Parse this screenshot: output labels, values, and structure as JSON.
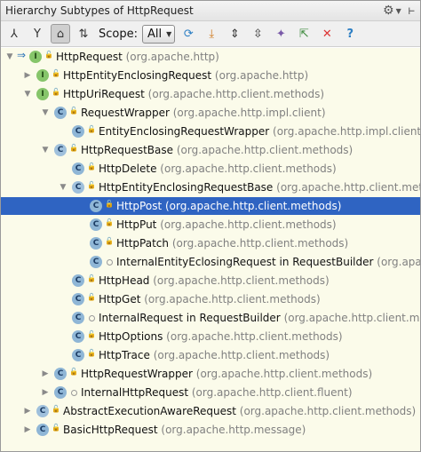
{
  "window": {
    "title": "Hierarchy Subtypes of HttpRequest"
  },
  "toolbar": {
    "scope_label": "Scope:",
    "scope_value": "All",
    "buttons": [
      {
        "name": "supertypes-hierarchy-icon",
        "glyph": "⅄"
      },
      {
        "name": "subtypes-hierarchy-icon",
        "glyph": "Y"
      },
      {
        "name": "class-hierarchy-icon",
        "glyph": "⌂",
        "active": true
      },
      {
        "name": "sort-alphabetically-icon",
        "glyph": "⇅"
      },
      {
        "name": "refresh-icon",
        "glyph": "⟳"
      },
      {
        "name": "export-icon",
        "glyph": "⤓"
      },
      {
        "name": "expand-all-icon",
        "glyph": "⇕"
      },
      {
        "name": "collapse-all-icon",
        "glyph": "⇳"
      },
      {
        "name": "pin-icon",
        "glyph": "✦"
      },
      {
        "name": "export-to-file-icon",
        "glyph": "⇱"
      },
      {
        "name": "close-icon",
        "glyph": "✕"
      },
      {
        "name": "help-icon",
        "glyph": "?"
      }
    ]
  },
  "tree": [
    {
      "depth": 0,
      "toggle": "▼",
      "kind": "int",
      "glyph": "I",
      "generic": true,
      "name": "HttpRequest",
      "pkg": "(org.apache.http)"
    },
    {
      "depth": 1,
      "toggle": "▶",
      "kind": "int",
      "glyph": "I",
      "name": "HttpEntityEnclosingRequest",
      "pkg": "(org.apache.http)"
    },
    {
      "depth": 1,
      "toggle": "▼",
      "kind": "int",
      "glyph": "I",
      "name": "HttpUriRequest",
      "pkg": "(org.apache.http.client.methods)"
    },
    {
      "depth": 2,
      "toggle": "▼",
      "kind": "class",
      "glyph": "C",
      "name": "RequestWrapper",
      "pkg": "(org.apache.http.impl.client)"
    },
    {
      "depth": 3,
      "toggle": "",
      "kind": "class",
      "glyph": "C",
      "name": "EntityEnclosingRequestWrapper",
      "pkg": "(org.apache.http.impl.client)"
    },
    {
      "depth": 2,
      "toggle": "▼",
      "kind": "abs",
      "glyph": "C",
      "name": "HttpRequestBase",
      "pkg": "(org.apache.http.client.methods)"
    },
    {
      "depth": 3,
      "toggle": "",
      "kind": "class",
      "glyph": "C",
      "name": "HttpDelete",
      "pkg": "(org.apache.http.client.methods)"
    },
    {
      "depth": 3,
      "toggle": "▼",
      "kind": "abs",
      "glyph": "C",
      "name": "HttpEntityEnclosingRequestBase",
      "pkg": "(org.apache.http.client.metho"
    },
    {
      "depth": 4,
      "toggle": "",
      "kind": "class",
      "glyph": "C",
      "name": "HttpPost",
      "pkg": "(org.apache.http.client.methods)",
      "selected": true
    },
    {
      "depth": 4,
      "toggle": "",
      "kind": "class",
      "glyph": "C",
      "name": "HttpPut",
      "pkg": "(org.apache.http.client.methods)"
    },
    {
      "depth": 4,
      "toggle": "",
      "kind": "class",
      "glyph": "C",
      "name": "HttpPatch",
      "pkg": "(org.apache.http.client.methods)"
    },
    {
      "depth": 4,
      "toggle": "",
      "kind": "class",
      "glyph": "C",
      "open": true,
      "name": "InternalEntityEclosingRequest in RequestBuilder",
      "pkg": "(org.apa"
    },
    {
      "depth": 3,
      "toggle": "",
      "kind": "class",
      "glyph": "C",
      "name": "HttpHead",
      "pkg": "(org.apache.http.client.methods)"
    },
    {
      "depth": 3,
      "toggle": "",
      "kind": "class",
      "glyph": "C",
      "name": "HttpGet",
      "pkg": "(org.apache.http.client.methods)"
    },
    {
      "depth": 3,
      "toggle": "",
      "kind": "class",
      "glyph": "C",
      "open": true,
      "name": "InternalRequest in RequestBuilder",
      "pkg": "(org.apache.http.client.me"
    },
    {
      "depth": 3,
      "toggle": "",
      "kind": "class",
      "glyph": "C",
      "name": "HttpOptions",
      "pkg": "(org.apache.http.client.methods)"
    },
    {
      "depth": 3,
      "toggle": "",
      "kind": "class",
      "glyph": "C",
      "name": "HttpTrace",
      "pkg": "(org.apache.http.client.methods)"
    },
    {
      "depth": 2,
      "toggle": "▶",
      "kind": "class",
      "glyph": "C",
      "name": "HttpRequestWrapper",
      "pkg": "(org.apache.http.client.methods)"
    },
    {
      "depth": 2,
      "toggle": "▶",
      "kind": "class",
      "glyph": "C",
      "open": true,
      "name": "InternalHttpRequest",
      "pkg": "(org.apache.http.client.fluent)"
    },
    {
      "depth": 1,
      "toggle": "▶",
      "kind": "abs",
      "glyph": "C",
      "name": "AbstractExecutionAwareRequest",
      "pkg": "(org.apache.http.client.methods)"
    },
    {
      "depth": 1,
      "toggle": "▶",
      "kind": "class",
      "glyph": "C",
      "name": "BasicHttpRequest",
      "pkg": "(org.apache.http.message)"
    }
  ]
}
